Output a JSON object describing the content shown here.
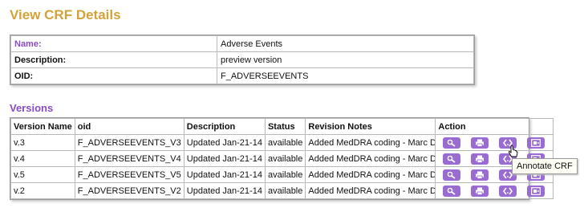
{
  "page": {
    "title": "View CRF Details"
  },
  "details": [
    {
      "label": "Name:",
      "value": "Adverse Events"
    },
    {
      "label": "Description:",
      "value": "preview version"
    },
    {
      "label": "OID:",
      "value": "F_ADVERSEEVENTS"
    }
  ],
  "versions": {
    "title": "Versions",
    "headers": [
      "Version Name",
      "oid",
      "Description",
      "Status",
      "Revision Notes",
      "Action"
    ],
    "rows": [
      {
        "version": "v.3",
        "oid": "F_ADVERSEEVENTS_V3",
        "description": "Updated Jan-21-14",
        "status": "available",
        "notes": "Added MedDRA coding - Marc D."
      },
      {
        "version": "v.4",
        "oid": "F_ADVERSEEVENTS_V4",
        "description": "Updated Jan-21-14",
        "status": "available",
        "notes": "Added MedDRA coding - Marc D."
      },
      {
        "version": "v.5",
        "oid": "F_ADVERSEEVENTS_V5",
        "description": "Updated Jan-21-14",
        "status": "available",
        "notes": "Added MedDRA coding - Marc D."
      },
      {
        "version": "v.2",
        "oid": "F_ADVERSEEVENTS_V2",
        "description": "Updated Jan-21-14",
        "status": "available",
        "notes": "Added MedDRA coding - Marc D."
      }
    ],
    "action_icons": [
      "view-icon",
      "print-icon",
      "metadata-icon",
      "annotate-icon"
    ]
  },
  "tooltip": {
    "text": "Annotate CRF"
  },
  "colors": {
    "title": "#d1a33a",
    "accent": "#8a4cc0",
    "button": "#9a6bd1"
  }
}
